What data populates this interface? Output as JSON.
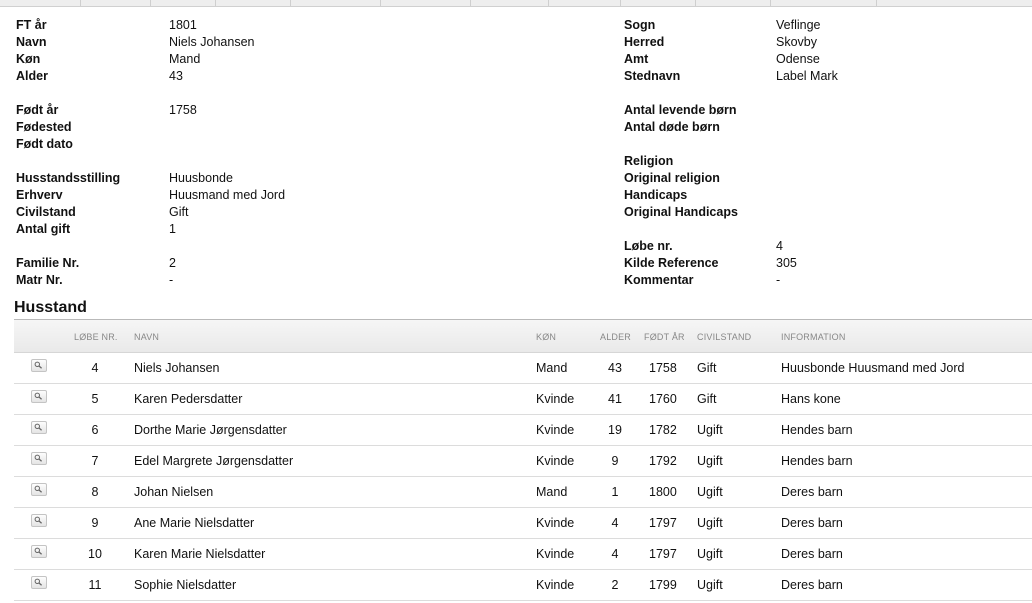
{
  "person": {
    "left": [
      {
        "label": "FT år",
        "value": "1801"
      },
      {
        "label": "Navn",
        "value": "Niels Johansen"
      },
      {
        "label": "Køn",
        "value": "Mand"
      },
      {
        "label": "Alder",
        "value": "43"
      },
      {
        "label": "Født år",
        "value": "1758"
      },
      {
        "label": "Fødested",
        "value": ""
      },
      {
        "label": "Født dato",
        "value": ""
      },
      {
        "label": "Husstandsstilling",
        "value": "Huusbonde"
      },
      {
        "label": "Erhverv",
        "value": "Huusmand med Jord"
      },
      {
        "label": "Civilstand",
        "value": "Gift"
      },
      {
        "label": "Antal gift",
        "value": "1"
      },
      {
        "label": "Familie Nr.",
        "value": "2"
      },
      {
        "label": "Matr Nr.",
        "value": "-"
      }
    ],
    "right": [
      {
        "label": "Sogn",
        "value": "Veflinge"
      },
      {
        "label": "Herred",
        "value": "Skovby"
      },
      {
        "label": "Amt",
        "value": "Odense"
      },
      {
        "label": "Stednavn",
        "value": "Label Mark"
      },
      {
        "label": "Antal levende børn",
        "value": ""
      },
      {
        "label": "Antal døde børn",
        "value": ""
      },
      {
        "label": "Religion",
        "value": ""
      },
      {
        "label": "Original religion",
        "value": ""
      },
      {
        "label": "Handicaps",
        "value": ""
      },
      {
        "label": "Original Handicaps",
        "value": ""
      },
      {
        "label": "Løbe nr.",
        "value": "4"
      },
      {
        "label": "Kilde Reference",
        "value": "305"
      },
      {
        "label": "Kommentar",
        "value": "-"
      }
    ]
  },
  "household": {
    "title": "Husstand",
    "columns": [
      "LØBE NR.",
      "NAVN",
      "KØN",
      "ALDER",
      "FØDT ÅR",
      "CIVILSTAND",
      "INFORMATION"
    ],
    "rows": [
      {
        "nr": "4",
        "navn": "Niels Johansen",
        "kon": "Mand",
        "alder": "43",
        "fodt": "1758",
        "civil": "Gift",
        "info": "Huusbonde Huusmand med Jord"
      },
      {
        "nr": "5",
        "navn": "Karen Pedersdatter",
        "kon": "Kvinde",
        "alder": "41",
        "fodt": "1760",
        "civil": "Gift",
        "info": "Hans kone"
      },
      {
        "nr": "6",
        "navn": "Dorthe Marie Jørgensdatter",
        "kon": "Kvinde",
        "alder": "19",
        "fodt": "1782",
        "civil": "Ugift",
        "info": "Hendes barn"
      },
      {
        "nr": "7",
        "navn": "Edel Margrete Jørgensdatter",
        "kon": "Kvinde",
        "alder": "9",
        "fodt": "1792",
        "civil": "Ugift",
        "info": "Hendes barn"
      },
      {
        "nr": "8",
        "navn": "Johan Nielsen",
        "kon": "Mand",
        "alder": "1",
        "fodt": "1800",
        "civil": "Ugift",
        "info": "Deres barn"
      },
      {
        "nr": "9",
        "navn": "Ane Marie Nielsdatter",
        "kon": "Kvinde",
        "alder": "4",
        "fodt": "1797",
        "civil": "Ugift",
        "info": "Deres barn"
      },
      {
        "nr": "10",
        "navn": "Karen Marie Nielsdatter",
        "kon": "Kvinde",
        "alder": "4",
        "fodt": "1797",
        "civil": "Ugift",
        "info": "Deres barn"
      },
      {
        "nr": "11",
        "navn": "Sophie Nielsdatter",
        "kon": "Kvinde",
        "alder": "2",
        "fodt": "1799",
        "civil": "Ugift",
        "info": "Deres barn"
      }
    ]
  },
  "icons": {
    "row_action": "magnifier-icon"
  }
}
